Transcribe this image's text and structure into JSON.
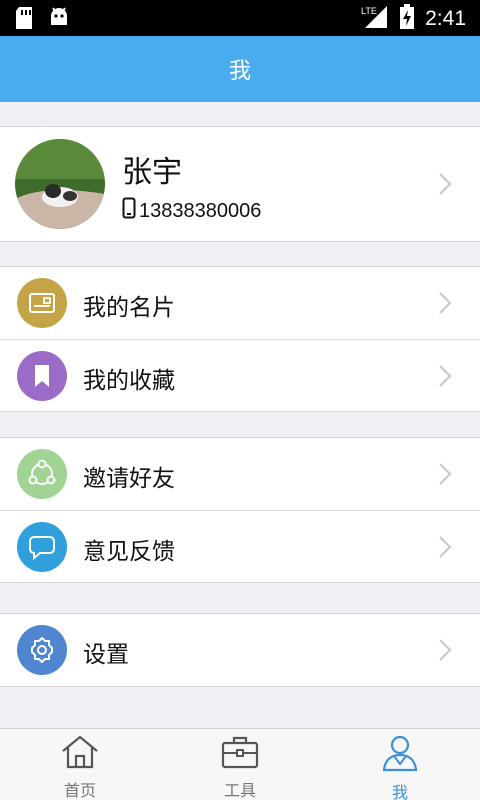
{
  "status_bar": {
    "time": "2:41",
    "network": "LTE"
  },
  "header": {
    "title": "我"
  },
  "profile": {
    "name": "张宇",
    "phone": "13838380006"
  },
  "menu_groups": [
    [
      {
        "label": "我的名片",
        "icon": "business-card-icon",
        "color": "#c4a447"
      },
      {
        "label": "我的收藏",
        "icon": "bookmark-icon",
        "color": "#9b6cc7"
      }
    ],
    [
      {
        "label": "邀请好友",
        "icon": "share-icon",
        "color": "#a1d493"
      },
      {
        "label": "意见反馈",
        "icon": "chat-bubble-icon",
        "color": "#2fa0dc"
      }
    ],
    [
      {
        "label": "设置",
        "icon": "gear-icon",
        "color": "#4f86cf"
      }
    ]
  ],
  "bottom_nav": [
    {
      "label": "首页",
      "icon": "home-icon",
      "active": false
    },
    {
      "label": "工具",
      "icon": "toolbox-icon",
      "active": false
    },
    {
      "label": "我",
      "icon": "user-icon",
      "active": true
    }
  ],
  "colors": {
    "primary": "#4aabee",
    "active_tab": "#3a8fd9",
    "background": "#efeff4"
  }
}
